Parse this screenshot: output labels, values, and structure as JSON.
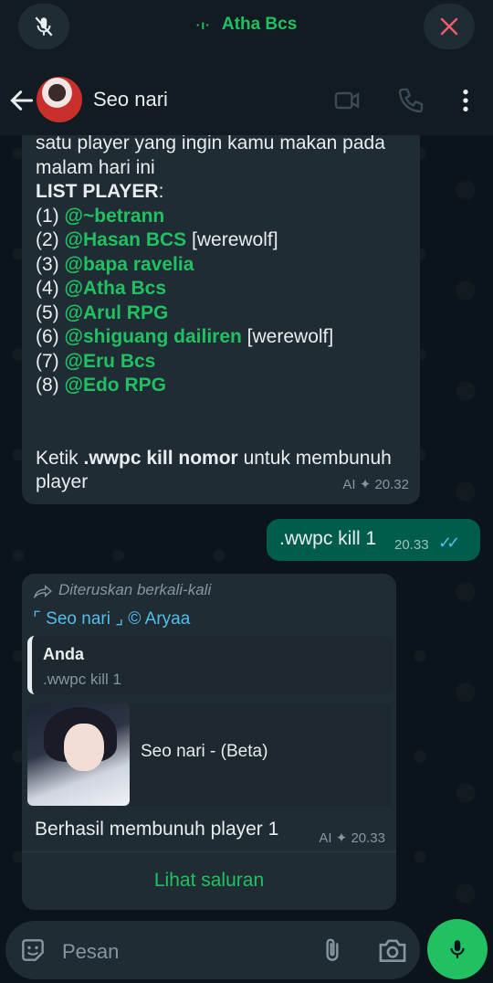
{
  "call": {
    "title": "Atha Bcs",
    "wave": "·ı·"
  },
  "header": {
    "name": "Seo nari"
  },
  "message1": {
    "line1": "satu player yang ingin kamu makan pada",
    "line2": "malam hari ini",
    "list_header": "LIST PLAYER",
    "list_colon": ":",
    "players": [
      {
        "num": "(1) ",
        "name": "@~betrann",
        "tag": ""
      },
      {
        "num": "(2) ",
        "name": "@Hasan BCS",
        "tag": " [werewolf]"
      },
      {
        "num": "(3) ",
        "name": "@bapa ravelia",
        "tag": ""
      },
      {
        "num": "(4) ",
        "name": "@Atha Bcs",
        "tag": ""
      },
      {
        "num": "(5) ",
        "name": "@Arul RPG",
        "tag": ""
      },
      {
        "num": "(6) ",
        "name": "@shiguang dailiren",
        "tag": " [werewolf]"
      },
      {
        "num": "(7) ",
        "name": "@Eru Bcs",
        "tag": ""
      },
      {
        "num": "(8) ",
        "name": "@Edo RPG",
        "tag": ""
      }
    ],
    "cmd_prefix": "Ketik ",
    "cmd_bold": ".wwpc kill nomor",
    "cmd_suffix": " untuk membunuh",
    "cmd_line2": "player",
    "meta": "AI ✦ 20.32"
  },
  "message2": {
    "text": ".wwpc kill 1",
    "time": "20.33",
    "ticks": "✓✓"
  },
  "message3": {
    "forwarded": "Diteruskan berkali-kali",
    "channel": "⌜ Seo nari ⌟ © Aryaa",
    "quote_author": "Anda",
    "quote_text": ".wwpc kill 1",
    "preview_title": "Seo nari - (Beta)",
    "body": "Berhasil membunuh player 1",
    "meta": "AI ✦ 20.33",
    "link_label": "Lihat saluran"
  },
  "composer": {
    "placeholder": "Pesan"
  },
  "colors": {
    "accent": "#21c063",
    "bubble_in": "#202c33",
    "bubble_out": "#005c4b",
    "link": "#53bdeb"
  }
}
